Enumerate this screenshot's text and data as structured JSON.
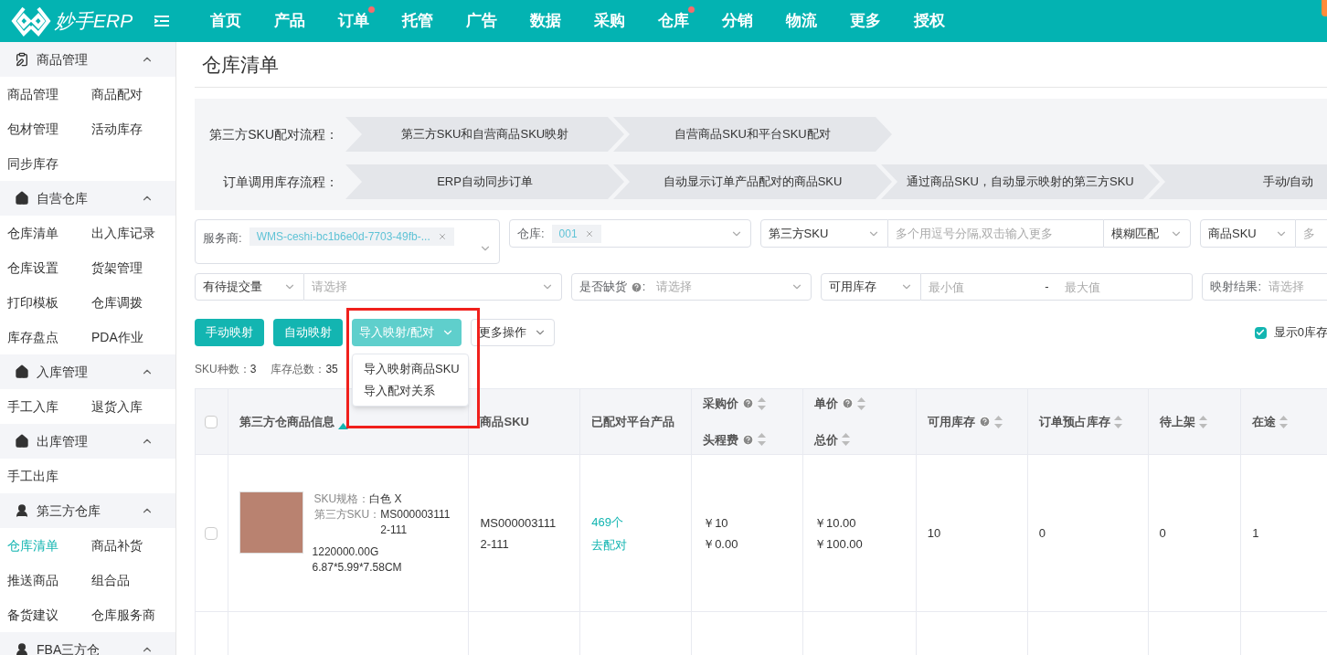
{
  "brand": "妙手ERP",
  "nav": [
    {
      "label": "首页",
      "dot": false
    },
    {
      "label": "产品",
      "dot": false
    },
    {
      "label": "订单",
      "dot": true
    },
    {
      "label": "托管",
      "dot": false
    },
    {
      "label": "广告",
      "dot": false
    },
    {
      "label": "数据",
      "dot": false
    },
    {
      "label": "采购",
      "dot": false
    },
    {
      "label": "仓库",
      "dot": true
    },
    {
      "label": "分销",
      "dot": false
    },
    {
      "label": "物流",
      "dot": false
    },
    {
      "label": "更多",
      "dot": false
    },
    {
      "label": "授权",
      "dot": false
    }
  ],
  "sidebar": [
    {
      "title": "商品管理",
      "kind": "clipboard",
      "expanded": true,
      "items": [
        {
          "label": "商品管理",
          "selected": false
        },
        {
          "label": "商品配对",
          "selected": false
        },
        {
          "label": "包材管理",
          "selected": false
        },
        {
          "label": "活动库存",
          "selected": false
        },
        {
          "label": "同步库存",
          "selected": false
        }
      ]
    },
    {
      "title": "自营仓库",
      "kind": "house",
      "expanded": true,
      "items": [
        {
          "label": "仓库清单",
          "selected": false
        },
        {
          "label": "出入库记录",
          "selected": false
        },
        {
          "label": "仓库设置",
          "selected": false
        },
        {
          "label": "货架管理",
          "selected": false
        },
        {
          "label": "打印模板",
          "selected": false
        },
        {
          "label": "仓库调拨",
          "selected": false
        },
        {
          "label": "库存盘点",
          "selected": false
        },
        {
          "label": "PDA作业",
          "selected": false
        }
      ]
    },
    {
      "title": "入库管理",
      "kind": "house",
      "expanded": true,
      "items": [
        {
          "label": "手工入库",
          "selected": false
        },
        {
          "label": "退货入库",
          "selected": false
        }
      ]
    },
    {
      "title": "出库管理",
      "kind": "house",
      "expanded": true,
      "items": [
        {
          "label": "手工出库",
          "selected": false
        }
      ]
    },
    {
      "title": "第三方仓库",
      "kind": "person",
      "expanded": true,
      "items": [
        {
          "label": "仓库清单",
          "selected": true
        },
        {
          "label": "商品补货",
          "selected": false
        },
        {
          "label": "推送商品",
          "selected": false
        },
        {
          "label": "组合品",
          "selected": false
        },
        {
          "label": "备货建议",
          "selected": false
        },
        {
          "label": "仓库服务商",
          "selected": false
        }
      ]
    },
    {
      "title": "FBA三方仓",
      "kind": "person",
      "expanded": true
    }
  ],
  "page_title": "仓库清单",
  "flows": [
    {
      "label": "第三方SKU配对流程：",
      "steps": [
        "第三方SKU和自营商品SKU映射",
        "自营商品SKU和平台SKU配对"
      ]
    },
    {
      "label": "订单调用库存流程：",
      "steps": [
        "ERP自动同步订单",
        "自动显示订单产品配对的商品SKU",
        "通过商品SKU，自动显示映射的第三方SKU",
        "手动/自动"
      ]
    }
  ],
  "filters_row1": {
    "provider": {
      "label": "服务商:",
      "tag": "WMS-ceshi-bc1b6e0d-7703-49fb-..."
    },
    "warehouse": {
      "label": "仓库:",
      "tag": "001"
    },
    "third_sku": {
      "select": "第三方SKU",
      "placeholder": "多个用逗号分隔,双击输入更多",
      "match": "模糊匹配"
    },
    "goods_sku": {
      "select": "商品SKU",
      "placeholder": "多"
    }
  },
  "filters_row2": {
    "pending": {
      "select": "有待提交量",
      "placeholder": "请选择"
    },
    "shortage": {
      "label": "是否缺货",
      "colon": ":",
      "placeholder": "请选择"
    },
    "stock": {
      "select": "可用库存",
      "min_placeholder": "最小值",
      "dash": "-",
      "max_placeholder": "最大值"
    },
    "mapping": {
      "label": "映射结果:",
      "placeholder": "请选择"
    }
  },
  "actions": [
    {
      "label": "手动映射",
      "kind": "button"
    },
    {
      "label": "自动映射",
      "kind": "button"
    },
    {
      "label": "导入映射/配对",
      "kind": "dropdown",
      "expanded": true,
      "menu": [
        "导入映射商品SKU",
        "导入配对关系"
      ]
    },
    {
      "label": "更多操作",
      "kind": "outline",
      "expanded": false
    }
  ],
  "show_zero": {
    "label": "显示0库存",
    "checked": true
  },
  "stats": [
    {
      "label": "SKU种数：",
      "value": "3"
    },
    {
      "label": "库存总数：",
      "value": "35"
    }
  ],
  "all_checked": false,
  "columns": [
    {
      "lines": [
        {
          "label": "第三方仓商品信息",
          "help": false,
          "sorted": true
        }
      ]
    },
    {
      "lines": [
        {
          "label": "商品SKU",
          "help": false
        }
      ]
    },
    {
      "lines": [
        {
          "label": "已配对平台产品",
          "help": false
        }
      ]
    },
    {
      "lines": [
        {
          "label": "采购价",
          "help": true,
          "sorted": false
        },
        {
          "label": "头程费",
          "help": true,
          "sorted": false
        }
      ]
    },
    {
      "lines": [
        {
          "label": "单价",
          "help": true,
          "sorted": false
        },
        {
          "label": "总价",
          "help": false,
          "sorted": false
        }
      ]
    },
    {
      "lines": [
        {
          "label": "可用库存",
          "help": true,
          "sorted": false
        }
      ]
    },
    {
      "lines": [
        {
          "label": "订单预占库存",
          "help": false,
          "sorted": false
        }
      ]
    },
    {
      "lines": [
        {
          "label": "待上架",
          "help": false,
          "sorted": false
        }
      ]
    },
    {
      "lines": [
        {
          "label": "在途",
          "help": false,
          "sorted": false
        }
      ]
    }
  ],
  "rows": [
    {
      "checked": false,
      "spec_label": "SKU规格：",
      "spec": "白色 X",
      "sku_label": "第三方SKU：",
      "sku": "MS0000031112-111",
      "weight": "1220000.00G",
      "size": "6.87*5.99*7.58CM",
      "goods_sku": "MS0000031112-111",
      "paired": "469个",
      "pair_link": "去配对",
      "purchase": "￥10",
      "freight": "￥0.00",
      "unit": "￥10.00",
      "total": "￥100.00",
      "available": "10",
      "reserved": "0",
      "pending": "0",
      "transit": "1"
    }
  ]
}
